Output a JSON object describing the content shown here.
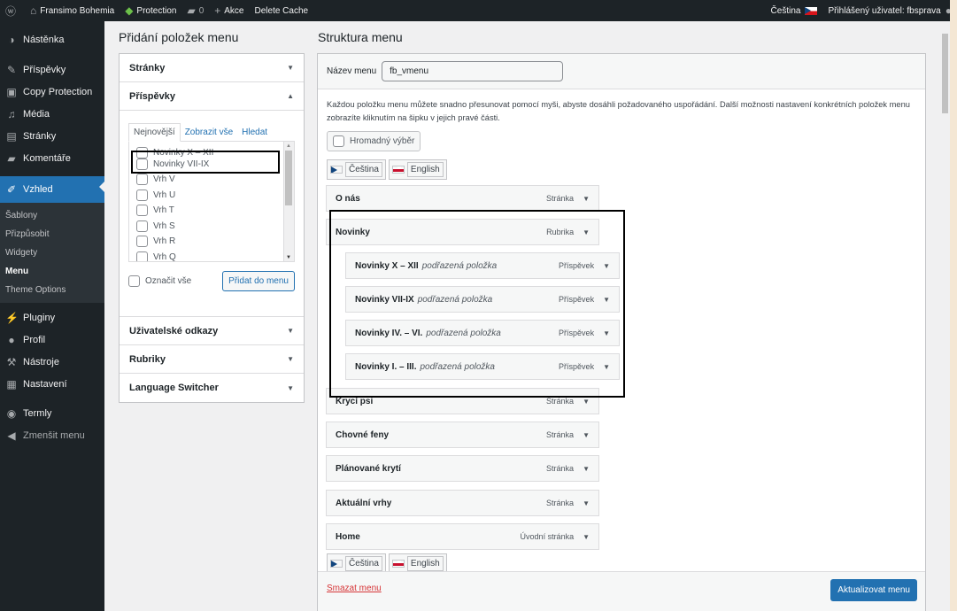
{
  "adminbar": {
    "site": "Fransimo Bohemia",
    "protection": "Protection",
    "comments": "0",
    "new": "Akce",
    "cache": "Delete Cache",
    "lang": "Čeština",
    "user": "Přihlášený uživatel: fbsprava"
  },
  "sidebar": {
    "items": [
      {
        "label": "Nástěnka",
        "icon": "dashboard-icon"
      },
      {
        "label": "Příspěvky",
        "icon": "pin-icon"
      },
      {
        "label": "Copy Protection",
        "icon": "lock-icon"
      },
      {
        "label": "Média",
        "icon": "media-icon"
      },
      {
        "label": "Stránky",
        "icon": "pages-icon"
      },
      {
        "label": "Komentáře",
        "icon": "comment-icon"
      },
      {
        "label": "Vzhled",
        "icon": "brush-icon"
      }
    ],
    "sub": [
      "Šablony",
      "Přizpůsobit",
      "Widgety",
      "Menu",
      "Theme Options"
    ],
    "items2": [
      {
        "label": "Pluginy",
        "icon": "plugin-icon"
      },
      {
        "label": "Profil",
        "icon": "user-icon"
      },
      {
        "label": "Nástroje",
        "icon": "wrench-icon"
      },
      {
        "label": "Nastavení",
        "icon": "settings-icon"
      },
      {
        "label": "Termly",
        "icon": "termly-icon"
      },
      {
        "label": "Zmenšit menu",
        "icon": "collapse-icon"
      }
    ]
  },
  "left": {
    "title": "Přidání položek menu",
    "pages": "Stránky",
    "posts": "Příspěvky",
    "tabs": [
      "Nejnovější",
      "Zobrazit vše",
      "Hledat"
    ],
    "list": [
      "Novinky X – XII",
      "Novinky VII-IX",
      "Vrh V",
      "Vrh U",
      "Vrh T",
      "Vrh S",
      "Vrh R",
      "Vrh Q"
    ],
    "select_all": "Označit vše",
    "add_btn": "Přidat do menu",
    "links": "Uživatelské odkazy",
    "cats": "Rubriky",
    "lang_switch": "Language Switcher"
  },
  "right": {
    "title": "Struktura menu",
    "name_label": "Název menu",
    "name_value": "fb_vmenu",
    "instructions": "Každou položku menu můžete snadno přesunovat pomocí myši, abyste dosáhli požadovaného uspořádání. Další možnosti nastavení konkrétních položek menu zobrazíte kliknutím na šipku v jejich pravé části.",
    "bulk": "Hromadný výběr",
    "lang_cs": "Čeština",
    "lang_en": "English",
    "items": [
      {
        "title": "O nás",
        "type": "Stránka",
        "sub": ""
      },
      {
        "title": "Novinky",
        "type": "Rubrika",
        "sub": ""
      },
      {
        "title": "Novinky X – XII",
        "type": "Příspěvek",
        "sub": "podřazená položka"
      },
      {
        "title": "Novinky VII-IX",
        "type": "Příspěvek",
        "sub": "podřazená položka"
      },
      {
        "title": "Novinky IV. – VI.",
        "type": "Příspěvek",
        "sub": "podřazená položka"
      },
      {
        "title": "Novinky I. – III.",
        "type": "Příspěvek",
        "sub": "podřazená položka"
      },
      {
        "title": "Krycí psi",
        "type": "Stránka",
        "sub": ""
      },
      {
        "title": "Chovné feny",
        "type": "Stránka",
        "sub": ""
      },
      {
        "title": "Plánované krytí",
        "type": "Stránka",
        "sub": ""
      },
      {
        "title": "Aktuální vrhy",
        "type": "Stránka",
        "sub": ""
      },
      {
        "title": "Home",
        "type": "Úvodní stránka",
        "sub": ""
      }
    ],
    "delete": "Smazat menu",
    "save": "Aktualizovat menu"
  }
}
